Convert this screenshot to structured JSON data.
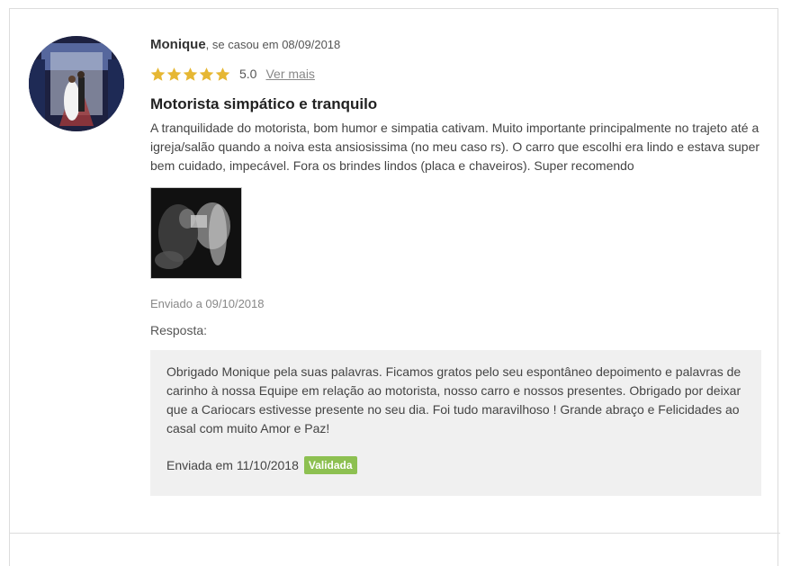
{
  "review": {
    "author_name": "Monique",
    "author_suffix": ", se casou em 08/09/2018",
    "rating_value": "5.0",
    "rating_stars": 5,
    "see_more": "Ver mais",
    "title": "Motorista simpático e tranquilo",
    "text": "A tranquilidade do motorista, bom humor e simpatia cativam. Muito importante principalmente no trajeto até a igreja/salão quando a noiva esta ansiosissima (no meu caso rs). O carro que escolhi era lindo e estava super bem cuidado, impecável. Fora os brindes lindos (placa e chaveiros). Super recomendo",
    "sent_date": "Enviado a 09/10/2018"
  },
  "reply": {
    "label": "Resposta:",
    "text": "Obrigado Monique pela suas palavras. Ficamos gratos pelo seu espontâneo depoimento e palavras de carinho à nossa Equipe em relação ao motorista, nosso carro e nossos presentes. Obrigado por deixar que a Cariocars estivesse presente no seu dia. Foi tudo maravilhoso ! Grande abraço e Felicidades ao casal com muito Amor e Paz!",
    "sent_date": "Enviada em 11/10/2018",
    "badge": "Validada"
  },
  "colors": {
    "star": "#e6b733",
    "badge": "#8dc051",
    "reply_bg": "#f0f0f0"
  }
}
